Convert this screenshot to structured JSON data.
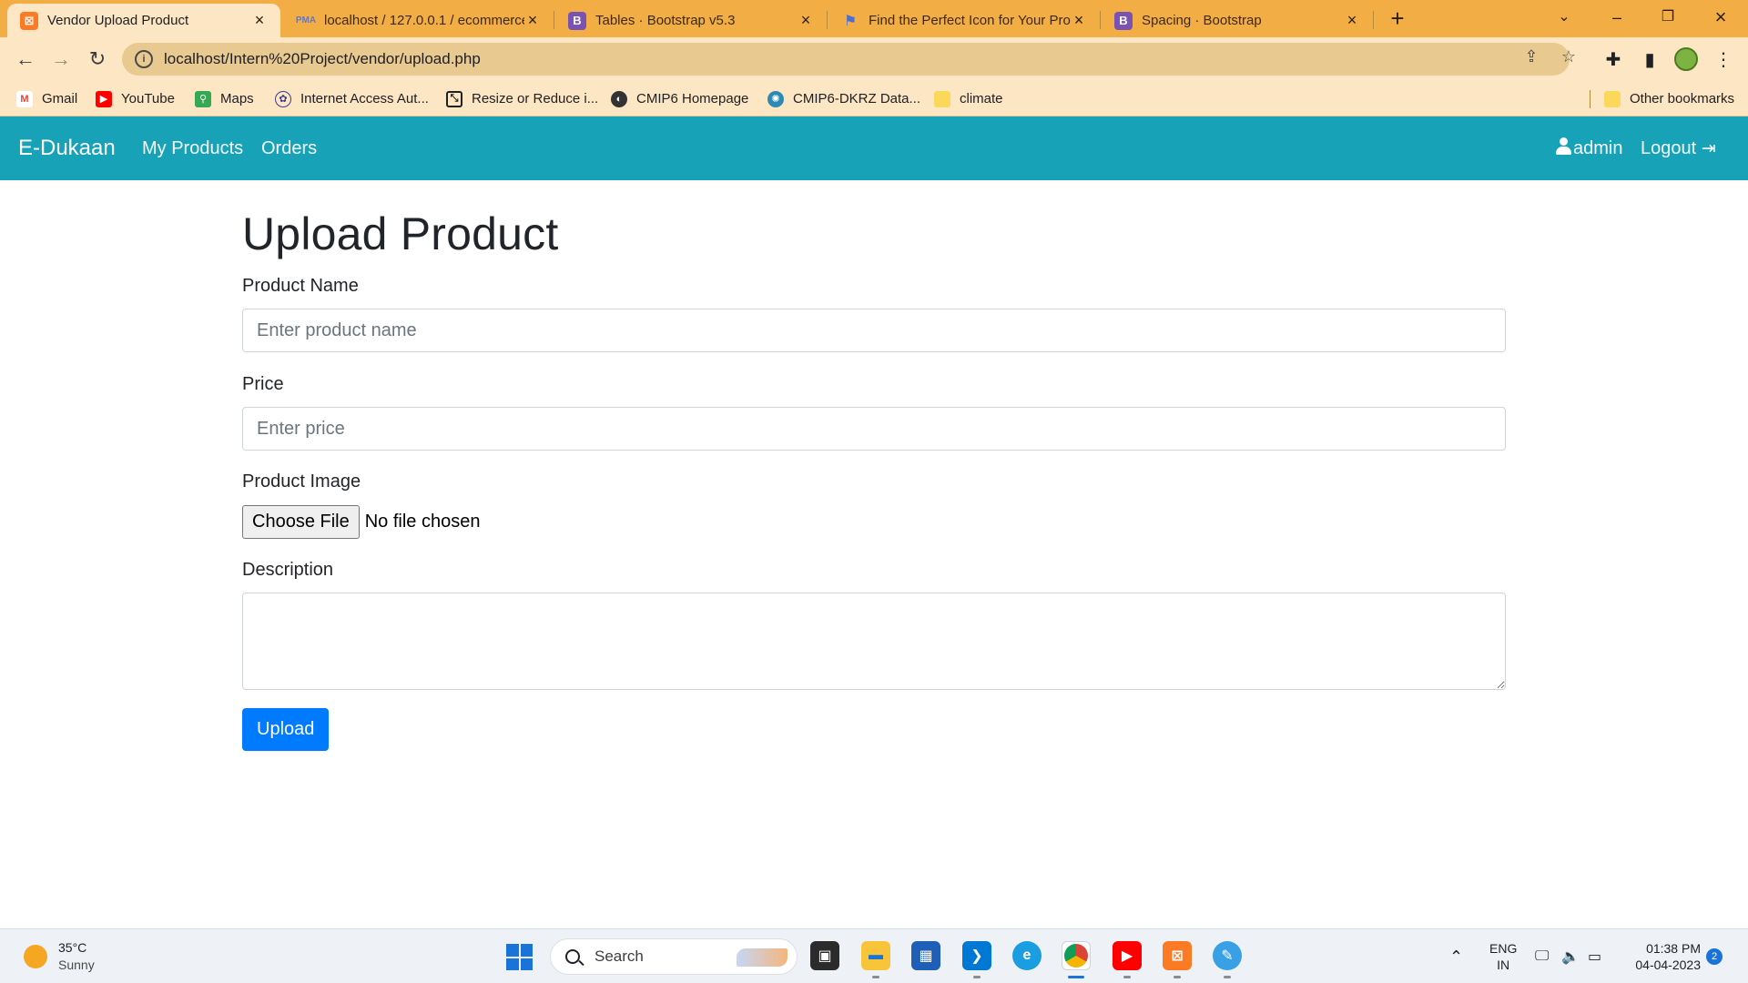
{
  "browser": {
    "tabs": [
      {
        "title": "Vendor Upload Product",
        "favicon": "xampp-icon",
        "active": true
      },
      {
        "title": "localhost / 127.0.0.1 / ecommerce",
        "favicon": "phpmyadmin-icon",
        "active": false
      },
      {
        "title": "Tables · Bootstrap v5.3",
        "favicon": "bootstrap-icon",
        "active": false
      },
      {
        "title": "Find the Perfect Icon for Your Pro",
        "favicon": "flag-icon",
        "active": false
      },
      {
        "title": "Spacing · Bootstrap",
        "favicon": "bootstrap-icon",
        "active": false
      }
    ],
    "url": "localhost/Intern%20Project/vendor/upload.php",
    "bookmarks": [
      {
        "label": "Gmail",
        "icon": "gmail-icon"
      },
      {
        "label": "YouTube",
        "icon": "youtube-icon"
      },
      {
        "label": "Maps",
        "icon": "maps-icon"
      },
      {
        "label": "Internet Access Aut...",
        "icon": "iit-icon"
      },
      {
        "label": "Resize or Reduce i...",
        "icon": "resize-icon"
      },
      {
        "label": "CMIP6 Homepage",
        "icon": "cmip6-icon"
      },
      {
        "label": "CMIP6-DKRZ Data...",
        "icon": "dkrz-icon"
      },
      {
        "label": "climate",
        "icon": "folder-icon"
      }
    ],
    "other_bookmarks": "Other bookmarks"
  },
  "app": {
    "brand": "E-Dukaan",
    "nav": [
      "My Products",
      "Orders"
    ],
    "user": "admin",
    "logout": "Logout"
  },
  "form": {
    "heading": "Upload Product",
    "product_name_label": "Product Name",
    "product_name_placeholder": "Enter product name",
    "price_label": "Price",
    "price_placeholder": "Enter price",
    "image_label": "Product Image",
    "choose_file": "Choose File",
    "file_status": "No file chosen",
    "description_label": "Description",
    "submit": "Upload"
  },
  "taskbar": {
    "temperature": "35°C",
    "weather": "Sunny",
    "search": "Search",
    "language": "ENG",
    "region": "IN",
    "time": "01:38 PM",
    "date": "04-04-2023",
    "notifications": "2"
  },
  "colors": {
    "tabstrip": "#f2ad45",
    "navbar": "#17a2b8",
    "primary_button": "#007bff"
  }
}
